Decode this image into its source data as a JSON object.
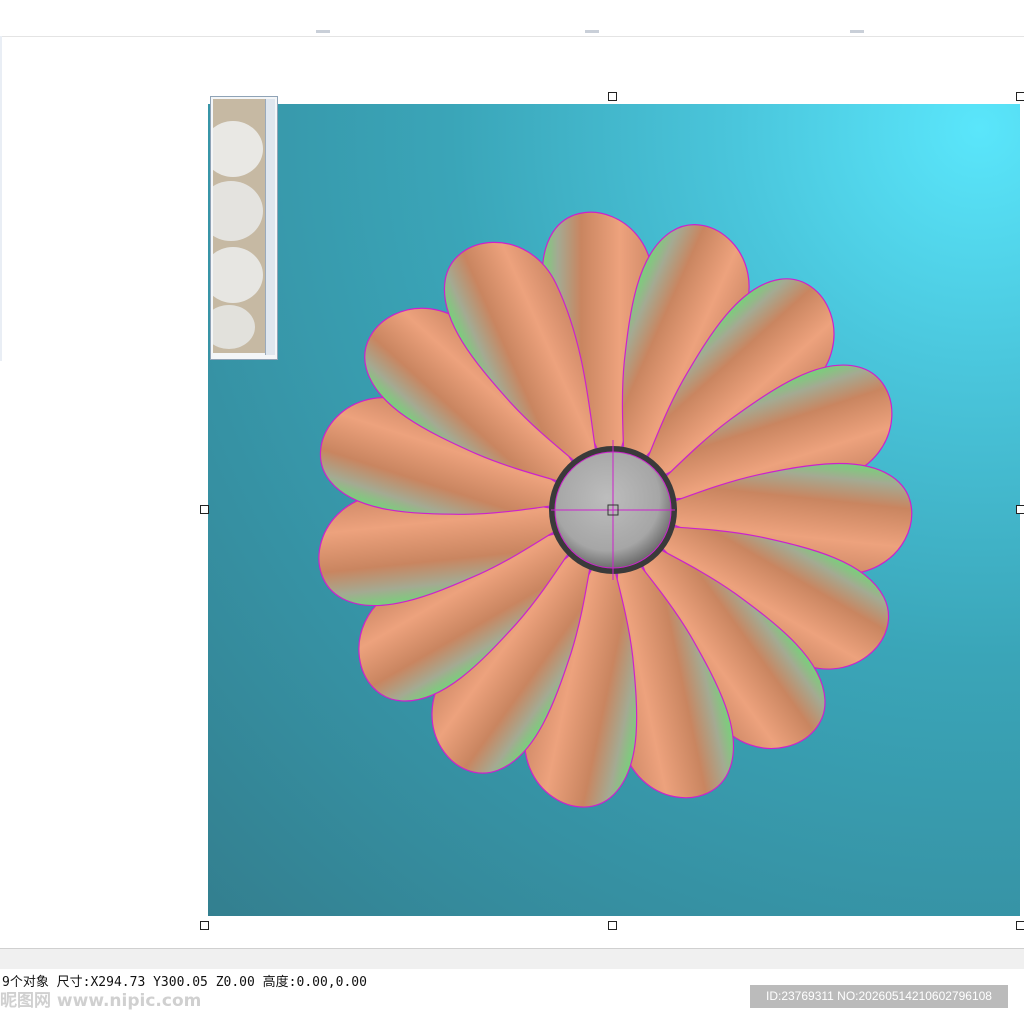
{
  "canvas": {
    "background_colors": [
      "#5ae6fb",
      "#3aa5b8",
      "#337f8f"
    ],
    "outline_color": "#cc22cc",
    "petal_colors": [
      "#c98560",
      "#eda27d",
      "#78d07a"
    ],
    "petal_count": 15,
    "center_disc_color": "#a9a9a9"
  },
  "thumbnail": {
    "icon": "stone-texture-thumbnail"
  },
  "status_bar": {
    "text": "9个对象 尺寸:X294.73 Y300.05 Z0.00 高度:0.00,0.00"
  },
  "watermark": {
    "site_text": "昵图网 www.nipic.com",
    "id_text": "ID:23769311 NO:20260514210602796108"
  }
}
